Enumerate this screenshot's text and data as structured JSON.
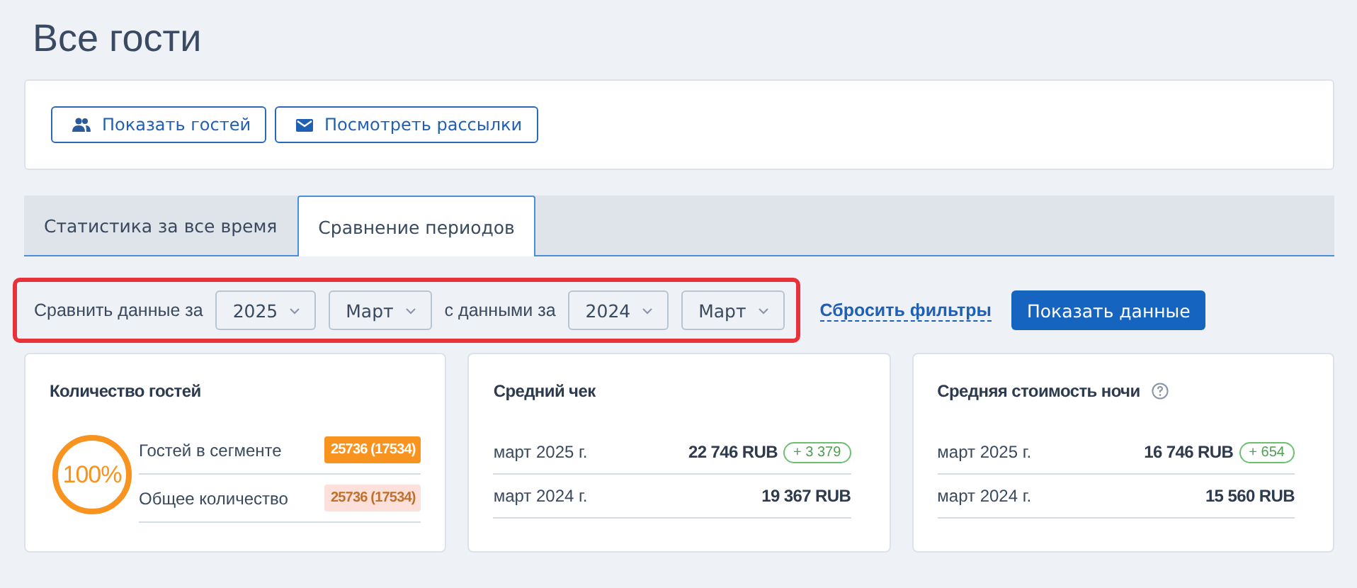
{
  "title": "Все гости",
  "actions": [
    {
      "label": "Показать гостей"
    },
    {
      "label": "Посмотреть рассылки"
    }
  ],
  "tabs": [
    {
      "label": "Статистика за все время",
      "selected": false
    },
    {
      "label": "Сравнение периодов",
      "selected": true
    }
  ],
  "filters": {
    "label": "Сравнить данные за",
    "year": "2025",
    "month": "Март",
    "label_2": "с данными за",
    "year_2": "2024",
    "month_2": "Март",
    "reset": "Сбросить фильтры",
    "submit": "Показать данные"
  },
  "guests_card": {
    "title": "Количество гостей",
    "percent": "100%",
    "level": 1,
    "rows": [
      {
        "label": "Гостей в сегменте",
        "value": "25736 (17534)",
        "kind": "filled"
      },
      {
        "label": "Общее количество",
        "value": "25736 (17534)",
        "kind": "light"
      }
    ]
  },
  "cards": [
    {
      "title": "Средний чек",
      "help": false,
      "rows": [
        {
          "label": "март 2025 г.",
          "value": "22 746 RUB",
          "delta": "+ 3 379"
        },
        {
          "label": "март 2024 г.",
          "value": "19 367 RUB"
        }
      ]
    },
    {
      "title": "Средняя стоимость ночи",
      "help": true,
      "rows": [
        {
          "label": "март 2025 г.",
          "value": "16 746 RUB",
          "delta": "+ 654"
        },
        {
          "label": "март 2024 г.",
          "value": "15 560 RUB"
        }
      ]
    }
  ]
}
